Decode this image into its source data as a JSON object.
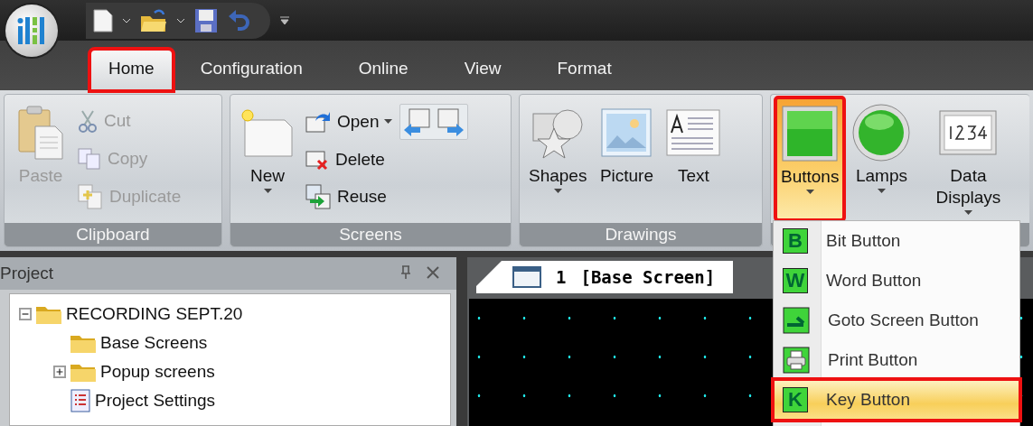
{
  "tabs": [
    {
      "label": "Home",
      "selected": true,
      "highlighted": true
    },
    {
      "label": "Configuration",
      "selected": false,
      "highlighted": false
    },
    {
      "label": "Online",
      "selected": false,
      "highlighted": false
    },
    {
      "label": "View",
      "selected": false,
      "highlighted": false
    },
    {
      "label": "Format",
      "selected": false,
      "highlighted": false
    }
  ],
  "ribbon": {
    "groups": [
      {
        "label": "Clipboard",
        "items": [
          {
            "kind": "large",
            "label": "Paste",
            "disabled": true,
            "dropdown": false,
            "selected": false,
            "highlighted": false
          },
          {
            "kind": "small",
            "label": "Cut",
            "disabled": true,
            "dropdown": false
          },
          {
            "kind": "small",
            "label": "Copy",
            "disabled": true,
            "dropdown": false
          },
          {
            "kind": "small",
            "label": "Duplicate",
            "disabled": true,
            "dropdown": false
          }
        ]
      },
      {
        "label": "Screens",
        "items": [
          {
            "kind": "large",
            "label": "New",
            "disabled": false,
            "dropdown": true,
            "selected": false,
            "highlighted": false
          },
          {
            "kind": "small",
            "label": "Open",
            "disabled": false,
            "dropdown": true
          },
          {
            "kind": "small",
            "label": "Delete",
            "disabled": false,
            "dropdown": false
          },
          {
            "kind": "small",
            "label": "Reuse",
            "disabled": false,
            "dropdown": false
          }
        ]
      },
      {
        "label": "Drawings",
        "items": [
          {
            "kind": "large",
            "label": "Shapes",
            "disabled": false,
            "dropdown": true,
            "selected": false,
            "highlighted": false
          },
          {
            "kind": "large",
            "label": "Picture",
            "disabled": false,
            "dropdown": false,
            "selected": false,
            "highlighted": false
          },
          {
            "kind": "large",
            "label": "Text",
            "disabled": false,
            "dropdown": false,
            "selected": false,
            "highlighted": false
          }
        ]
      },
      {
        "items": [
          {
            "kind": "large",
            "label": "Buttons",
            "disabled": false,
            "dropdown": true,
            "selected": true,
            "highlighted": true
          },
          {
            "kind": "large",
            "label": "Lamps",
            "disabled": false,
            "dropdown": true,
            "selected": false,
            "highlighted": false
          },
          {
            "kind": "large",
            "label": "Data Displays",
            "disabled": false,
            "dropdown": true,
            "selected": false,
            "highlighted": false
          }
        ]
      }
    ]
  },
  "project_panel": {
    "title": "Project",
    "tree": [
      {
        "label": "RECORDING SEPT.20",
        "kind": "folder",
        "expanded": true,
        "children": [
          {
            "label": "Base Screens",
            "kind": "folder"
          },
          {
            "label": "Popup screens",
            "kind": "folder",
            "expanded": false
          },
          {
            "label": "Project Settings",
            "kind": "document"
          }
        ]
      }
    ]
  },
  "editor": {
    "tabs": [
      {
        "number": "1",
        "title": "[Base Screen]",
        "selected": true
      }
    ]
  },
  "buttons_menu": {
    "items": [
      {
        "glyph": "B",
        "label": "Bit Button",
        "kind": "letter",
        "selected": false,
        "highlighted": false
      },
      {
        "glyph": "W",
        "label": "Word Button",
        "kind": "letter",
        "selected": false,
        "highlighted": false
      },
      {
        "label": "Goto Screen Button",
        "kind": "goto",
        "selected": false,
        "highlighted": false
      },
      {
        "label": "Print Button",
        "kind": "print",
        "selected": false,
        "highlighted": false
      },
      {
        "glyph": "K",
        "label": "Key Button",
        "kind": "letter",
        "selected": true,
        "highlighted": true
      }
    ]
  }
}
